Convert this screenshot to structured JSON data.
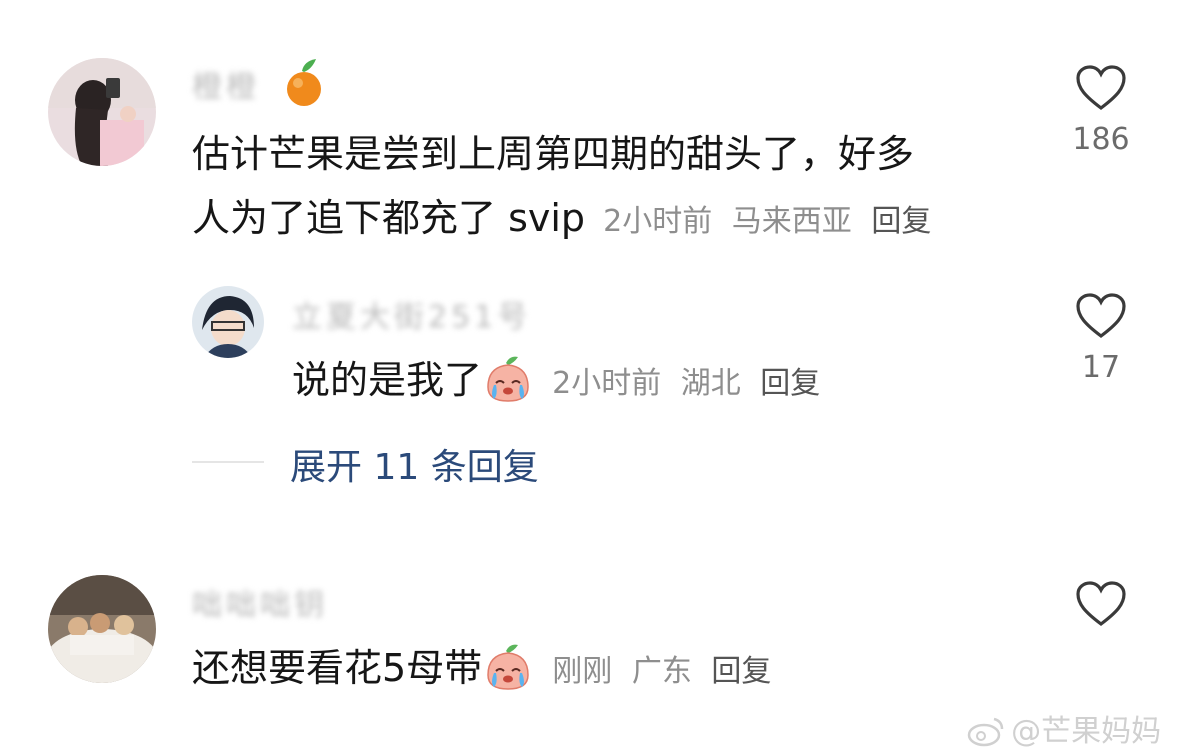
{
  "comments": [
    {
      "username": "橙橙",
      "text_line1": "估计芒果是尝到上周第四期的甜头了，好多",
      "text_line2": "人为了追下都充了 svip",
      "time": "2小时前",
      "location": "马来西亚",
      "reply_label": "回复",
      "likes": "186",
      "reply": {
        "username": "立夏大街251号",
        "text": "说的是我了",
        "time": "2小时前",
        "location": "湖北",
        "reply_label": "回复",
        "likes": "17"
      },
      "expand_label": "展开 11 条回复"
    },
    {
      "username": "咄咄咄钥",
      "text": "还想要看花5母带",
      "time": "刚刚",
      "location": "广东",
      "reply_label": "回复",
      "likes": ""
    }
  ],
  "watermark": "@芒果妈妈",
  "colors": {
    "expand_link": "#2b4a7a",
    "meta": "#8e8e8e"
  },
  "icons": {
    "like": "heart-outline-icon",
    "emoji": "crying-peach-emoji-icon",
    "badge": "orange-fruit-icon",
    "watermark_logo": "weibo-logo-icon"
  }
}
